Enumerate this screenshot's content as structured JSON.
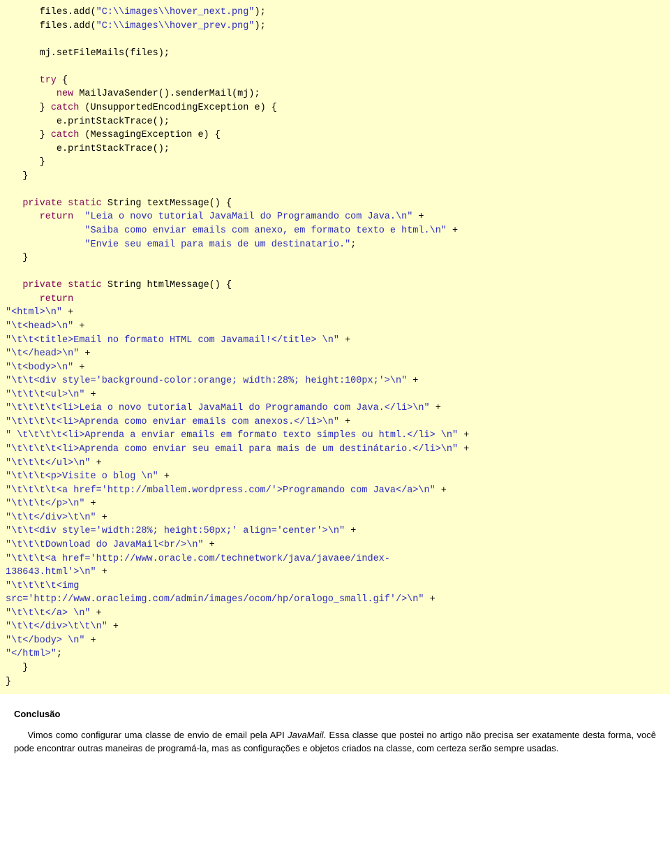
{
  "code": {
    "l1": "      files.add(",
    "l1s": "\"C:\\\\images\\\\hover_next.png\"",
    "l1e": ");",
    "l2": "      files.add(",
    "l2s": "\"C:\\\\images\\\\hover_prev.png\"",
    "l2e": ");",
    "l3": "      mj.setFileMails(files);",
    "l4a": "      ",
    "l4k": "try",
    "l4b": " {",
    "l5a": "         ",
    "l5k": "new",
    "l5b": " MailJavaSender().senderMail(mj);",
    "l6a": "      } ",
    "l6k": "catch",
    "l6b": " (UnsupportedEncodingException e) {",
    "l7": "         e.printStackTrace();",
    "l8a": "      } ",
    "l8k": "catch",
    "l8b": " (MessagingException e) {",
    "l9": "         e.printStackTrace();",
    "l10": "      }",
    "l11": "   }",
    "l12a": "   ",
    "l12k1": "private",
    "l12b": " ",
    "l12k2": "static",
    "l12c": " String textMessage() {",
    "l13a": "      ",
    "l13k": "return",
    "l13b": "  ",
    "l13s": "\"Leia o novo tutorial JavaMail do Programando com Java.\\n\"",
    "l13c": " +",
    "l14": "              ",
    "l14s": "\"Saiba como enviar emails com anexo, em formato texto e html.\\n\"",
    "l14c": " +",
    "l15": "              ",
    "l15s": "\"Envie seu email para mais de um destinatario.\"",
    "l15c": ";",
    "l16": "   }",
    "l17a": "   ",
    "l17k1": "private",
    "l17b": " ",
    "l17k2": "static",
    "l17c": " String htmlMessage() {",
    "l18a": "      ",
    "l18k": "return",
    "h1": "\"<html>\\n\"",
    "h2": "\"\\t<head>\\n\"",
    "h3": "\"\\t\\t<title>Email no formato HTML com Javamail!</title> \\n\"",
    "h4": "\"\\t</head>\\n\"",
    "h5": "\"\\t<body>\\n\"",
    "h6": "\"\\t\\t<div style='background-color:orange; width:28%; height:100px;'>\\n\"",
    "h7": "\"\\t\\t\\t<ul>\\n\"",
    "h8": "\"\\t\\t\\t\\t<li>Leia o novo tutorial JavaMail do Programando com Java.</li>\\n\"",
    "h9": "\"\\t\\t\\t\\t<li>Aprenda como enviar emails com anexos.</li>\\n\"",
    "h10": "\" \\t\\t\\t\\t<li>Aprenda a enviar emails em formato texto simples ou html.</li> \\n\"",
    "h11": "\"\\t\\t\\t\\t<li>Aprenda como enviar seu email para mais de um destinátario.</li>\\n\"",
    "h12": "\"\\t\\t\\t</ul>\\n\"",
    "h13": "\"\\t\\t\\t<p>Visite o blog \\n\"",
    "h14": "\"\\t\\t\\t\\t<a href='http://mballem.wordpress.com/'>Programando com Java</a>\\n\"",
    "h15": "\"\\t\\t\\t</p>\\n\"",
    "h16": "\"\\t\\t</div>\\t\\n\"",
    "h17": "\"\\t\\t<div style='width:28%; height:50px;' align='center'>\\n\"",
    "h18": "\"\\t\\t\\tDownload do JavaMail<br/>\\n\"",
    "h19a": "\"\\t\\t\\t<a href='http://www.oracle.com/technetwork/java/javaee/index-",
    "h19b": "138643.html'>\\n\"",
    "h20a": "\"\\t\\t\\t\\t<img ",
    "h20b": "src='http://www.oracleimg.com/admin/images/ocom/hp/oralogo_small.gif'/>\\n\"",
    "h21": "\"\\t\\t\\t</a> \\n\"",
    "h22": "\"\\t\\t</div>\\t\\t\\n\"",
    "h23": "\"\\t</body> \\n\"",
    "h24": "\"</html>\"",
    "end1": "   }",
    "end2": "}"
  },
  "conclusion": {
    "heading": "Conclusão",
    "p1a": "Vimos como configurar uma classe de envio de email pela API ",
    "p1i": "JavaMail",
    "p1b": ". Essa classe que postei no artigo não precisa ser exatamente desta forma, você pode encontrar outras maneiras de programá-la, mas as configurações e objetos criados na classe, com certeza serão sempre usadas."
  }
}
